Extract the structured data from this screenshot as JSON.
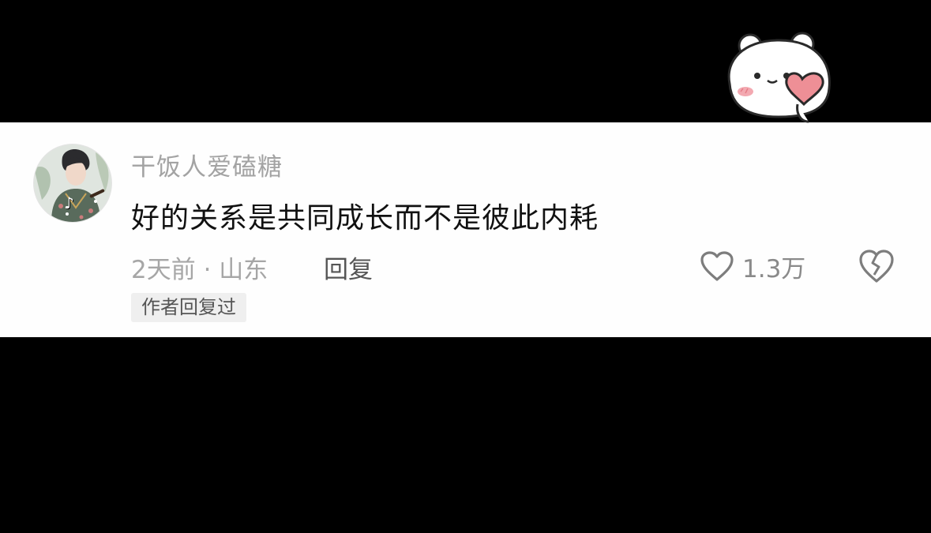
{
  "comment": {
    "username": "干饭人爱磕糖",
    "text": "好的关系是共同成长而不是彼此内耗",
    "time_location": "2天前 · 山东",
    "reply_label": "回复",
    "like_count": "1.3万",
    "author_badge": "作者回复过"
  },
  "icons": {
    "avatar": "avatar-image",
    "like": "heart-outline-icon",
    "dislike": "broken-heart-icon",
    "sticker": "bear-heart-sticker"
  },
  "colors": {
    "background": "#000000",
    "card": "#fefefe",
    "username": "#a3a3a3",
    "comment_text": "#111111",
    "meta": "#a6a6a6",
    "reply": "#555555",
    "sticker_heart": "#ee8f96"
  }
}
